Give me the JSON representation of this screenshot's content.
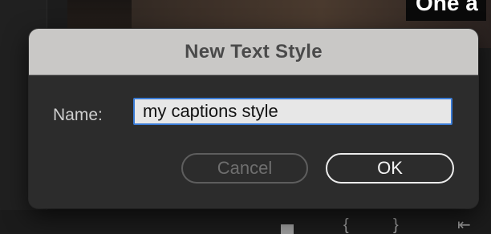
{
  "background": {
    "caption_fragment": "One a"
  },
  "dialog": {
    "title": "New Text Style",
    "name_label": "Name:",
    "name_value": "my captions style",
    "buttons": {
      "cancel": "Cancel",
      "ok": "OK"
    }
  },
  "colors": {
    "title_bar": "#c9c8c6",
    "dialog_bg": "#2c2c2c",
    "focus_ring": "#3a7bd5",
    "input_bg": "#e7e7e7"
  }
}
